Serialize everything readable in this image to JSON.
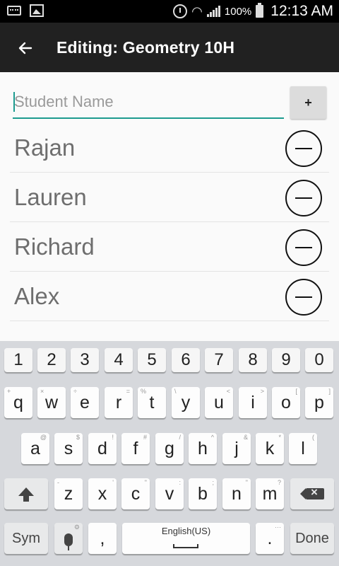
{
  "status_bar": {
    "battery_percent": "100%",
    "time": "12:13 AM",
    "icons": [
      "keyboard-notification-icon",
      "image-notification-icon",
      "alarm-icon",
      "wifi-icon",
      "signal-icon",
      "battery-icon"
    ]
  },
  "app_bar": {
    "title": "Editing: Geometry 10H",
    "back_icon": "arrow-left-icon"
  },
  "form": {
    "name_placeholder": "Student Name",
    "name_value": "",
    "add_label": "+"
  },
  "students": [
    {
      "name": "Rajan"
    },
    {
      "name": "Lauren"
    },
    {
      "name": "Richard"
    },
    {
      "name": "Alex"
    }
  ],
  "keyboard": {
    "numbers": [
      "1",
      "2",
      "3",
      "4",
      "5",
      "6",
      "7",
      "8",
      "9",
      "0"
    ],
    "row1": [
      "q",
      "w",
      "e",
      "r",
      "t",
      "y",
      "u",
      "i",
      "o",
      "p"
    ],
    "row1_hints": [
      "+",
      "×",
      "÷",
      "=",
      "%",
      "\\",
      "<",
      ">",
      "[",
      "]"
    ],
    "row2": [
      "a",
      "s",
      "d",
      "f",
      "g",
      "h",
      "j",
      "k",
      "l"
    ],
    "row2_hints": [
      "@",
      "$",
      "!",
      "#",
      "/",
      "^",
      "&",
      "*",
      "("
    ],
    "row3": [
      "z",
      "x",
      "c",
      "v",
      "b",
      "n",
      "m"
    ],
    "row3_hints": [
      "-",
      "'",
      "\"",
      ":",
      ";",
      "\"",
      "?"
    ],
    "sym_label": "Sym",
    "comma_label": ",",
    "space_label": "English(US)",
    "period_label": ".",
    "done_label": "Done"
  },
  "colors": {
    "accent": "#1d9b8f",
    "app_bar": "#212121",
    "keyboard_bg": "#d6d8dc"
  }
}
